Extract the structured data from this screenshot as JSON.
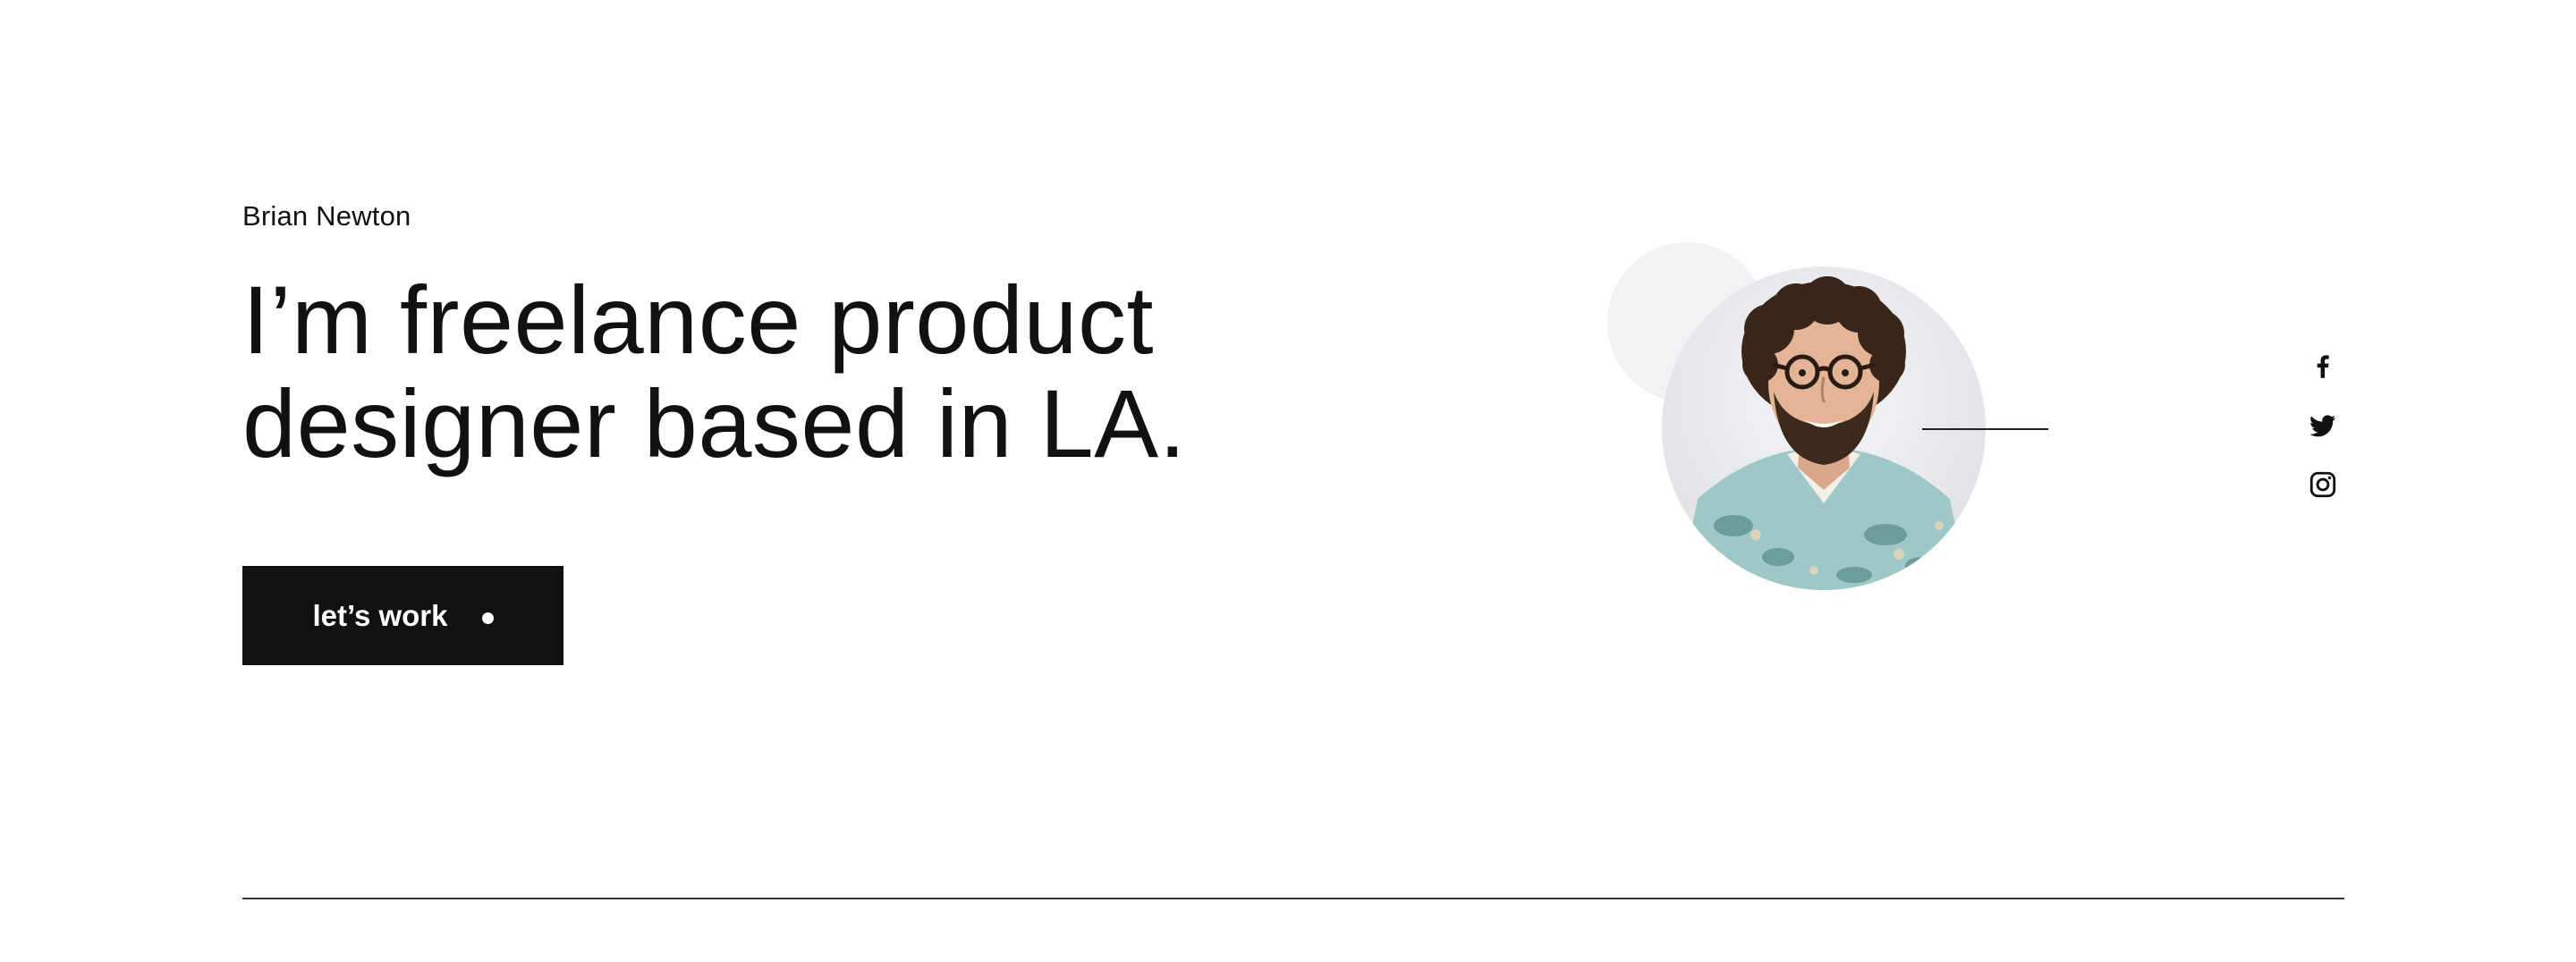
{
  "hero": {
    "name": "Brian Newton",
    "headline_line1": "I’m freelance product",
    "headline_line2": "designer based in LA.",
    "cta_label": "let’s work"
  },
  "social": {
    "icons": [
      "facebook-icon",
      "twitter-icon",
      "instagram-icon"
    ]
  },
  "colors": {
    "text": "#111111",
    "background": "#ffffff",
    "button": "#111111",
    "button_text": "#ffffff",
    "shirt": "#9ec8c8"
  }
}
